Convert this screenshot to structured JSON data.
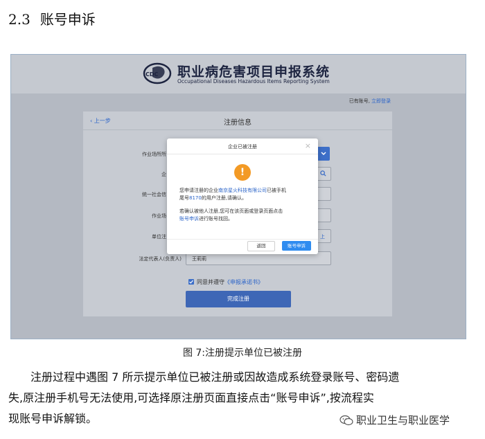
{
  "heading": {
    "number": "2.3",
    "title": "账号申诉"
  },
  "screenshot": {
    "system_title": "职业病危害项目申报系统",
    "system_subtitle": "Occupational Diseases Hazardous Items Reporting System",
    "logo_text": "CDC",
    "account_prompt": "已有账号,",
    "login_link": "立即登录",
    "card": {
      "back_label": "上一步",
      "title": "注册信息",
      "fields": [
        {
          "label": "作业场所所",
          "value": ""
        },
        {
          "label": "企",
          "value": ""
        },
        {
          "label": "统一社会信",
          "value": ""
        },
        {
          "label": "作业场",
          "value": ""
        },
        {
          "label": "单位注",
          "value": ""
        },
        {
          "label": "法定代表人(负责人)",
          "value": "王莉莉"
        }
      ],
      "upload_link": "上",
      "agree_text": "同意并遵守",
      "agree_link": "《申报承诺书》",
      "submit_label": "完成注册"
    },
    "modal": {
      "title": "企业已被注册",
      "close": "×",
      "msg_a": "您申请注册的企业",
      "company": "南京星火科技有限公司",
      "msg_b": "已被手机",
      "msg_c": "尾号",
      "phone_tail": "8170",
      "msg_d": "的用户注册,请确认。",
      "msg2_a": "若确认被他人注册,您可在该页面或登录页面点击",
      "msg2_link": "账号申诉",
      "msg2_b": "进行账号找回。",
      "back_button": "返回",
      "appeal_button": "账号申诉"
    }
  },
  "caption": "图 7:注册提示单位已被注册",
  "paragraph_lines": [
    "注册过程中遇图 7 所示提示单位已被注册或因故造成系统登录账号、密码遗",
    "失,原注册手机号无法使用,可选择原注册页面直接点击“账号申诉”,按流程实",
    "现账号申诉解锁。"
  ],
  "watermark": "职业卫生与职业医学",
  "colors": {
    "accent": "#2f8cf0",
    "warning": "#f39a25",
    "overlay": "#b4b9c2"
  }
}
